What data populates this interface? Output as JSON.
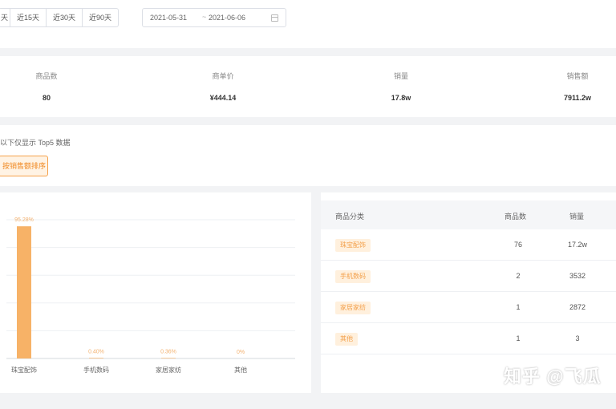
{
  "filter": {
    "ranges": [
      "天",
      "近15天",
      "近30天",
      "近90天"
    ],
    "date_start": "2021-05-31",
    "date_sep": "~",
    "date_end": "2021-06-06"
  },
  "stats": [
    {
      "label": "商品数",
      "value": "80"
    },
    {
      "label": "商单价",
      "value": "¥444.14"
    },
    {
      "label": "销量",
      "value": "17.8w"
    },
    {
      "label": "销售额",
      "value": "7911.2w"
    }
  ],
  "tip": {
    "text": "以下仅显示 Top5 数据",
    "sort_label": "按销售额排序"
  },
  "chart_data": {
    "type": "bar",
    "categories": [
      "珠宝配饰",
      "手机数码",
      "家居家纺",
      "其他"
    ],
    "values": [
      95.28,
      0.4,
      0.36,
      0
    ],
    "data_labels": [
      "95.28%",
      "0.40%",
      "0.36%",
      "0%"
    ],
    "ylim": [
      0,
      100
    ],
    "grid": true,
    "bar_color": "#f7b267"
  },
  "table": {
    "headers": {
      "category": "商品分类",
      "count": "商品数",
      "sales": "销量"
    },
    "rows": [
      {
        "category": "珠宝配饰",
        "count": "76",
        "sales": "17.2w"
      },
      {
        "category": "手机数码",
        "count": "2",
        "sales": "3532"
      },
      {
        "category": "家居家纺",
        "count": "1",
        "sales": "2872"
      },
      {
        "category": "其他",
        "count": "1",
        "sales": "3"
      }
    ]
  },
  "watermark": "知乎 @飞瓜"
}
